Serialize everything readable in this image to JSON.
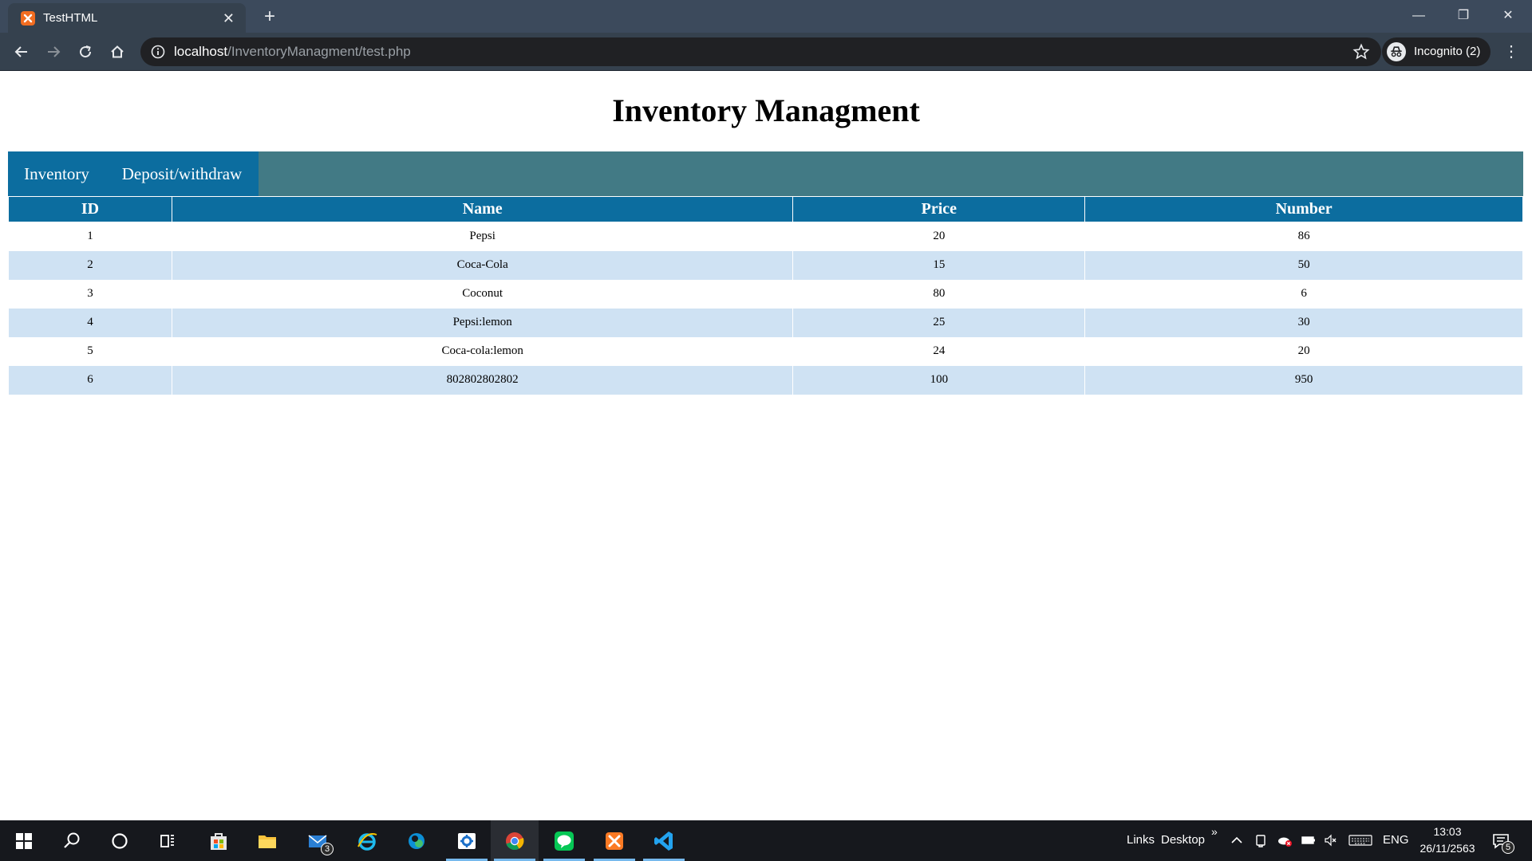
{
  "browser": {
    "tab_title": "TestHTML",
    "url_host": "localhost",
    "url_path": "/InventoryManagment/test.php",
    "incognito_label": "Incognito (2)"
  },
  "page": {
    "title": "Inventory Managment",
    "nav": [
      {
        "label": "Inventory"
      },
      {
        "label": "Deposit/withdraw"
      }
    ],
    "table": {
      "headers": [
        "ID",
        "Name",
        "Price",
        "Number"
      ],
      "rows": [
        [
          "1",
          "Pepsi",
          "20",
          "86"
        ],
        [
          "2",
          "Coca-Cola",
          "15",
          "50"
        ],
        [
          "3",
          "Coconut",
          "80",
          "6"
        ],
        [
          "4",
          "Pepsi:lemon",
          "25",
          "30"
        ],
        [
          "5",
          "Coca-cola:lemon",
          "24",
          "20"
        ],
        [
          "6",
          "802802802802",
          "100",
          "950"
        ]
      ]
    }
  },
  "taskbar": {
    "mail_badge": "3",
    "links_label": "Links",
    "desktop_label": "Desktop",
    "overflow_label": "»",
    "language": "ENG",
    "time": "13:03",
    "date": "26/11/2563",
    "notification_count": "5"
  },
  "colors": {
    "accent": "#0c6d9f",
    "navbar": "#427a85",
    "row_alt": "#cfe2f3"
  }
}
